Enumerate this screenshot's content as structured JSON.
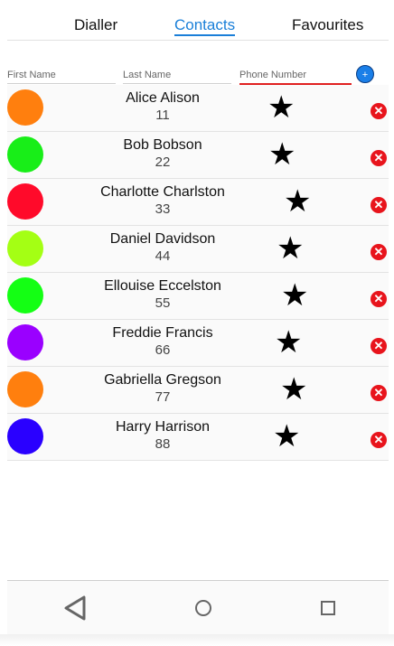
{
  "tabs": [
    {
      "label": "Dialler",
      "active": false
    },
    {
      "label": "Contacts",
      "active": true
    },
    {
      "label": "Favourites",
      "active": false
    }
  ],
  "form": {
    "first_name_placeholder": "First Name",
    "last_name_placeholder": "Last Name",
    "phone_placeholder": "Phone Number",
    "add_label": "+"
  },
  "contacts": [
    {
      "name": "Alice Alison",
      "phone": "11",
      "color": "#ff7f0e"
    },
    {
      "name": "Bob Bobson",
      "phone": "22",
      "color": "#18ee18"
    },
    {
      "name": "Charlotte Charlston",
      "phone": "33",
      "color": "#ff0a2a"
    },
    {
      "name": "Daniel Davidson",
      "phone": "44",
      "color": "#a4ff14"
    },
    {
      "name": "Ellouise Eccelston",
      "phone": "55",
      "color": "#14ff14"
    },
    {
      "name": "Freddie Francis",
      "phone": "66",
      "color": "#9a00ff"
    },
    {
      "name": "Gabriella Gregson",
      "phone": "77",
      "color": "#ff7f0e"
    },
    {
      "name": "Harry Harrison",
      "phone": "88",
      "color": "#2a00ff"
    }
  ],
  "icons": {
    "star": "★",
    "delete": "✕"
  },
  "navbar": [
    "back-icon",
    "home-icon",
    "recents-icon"
  ]
}
